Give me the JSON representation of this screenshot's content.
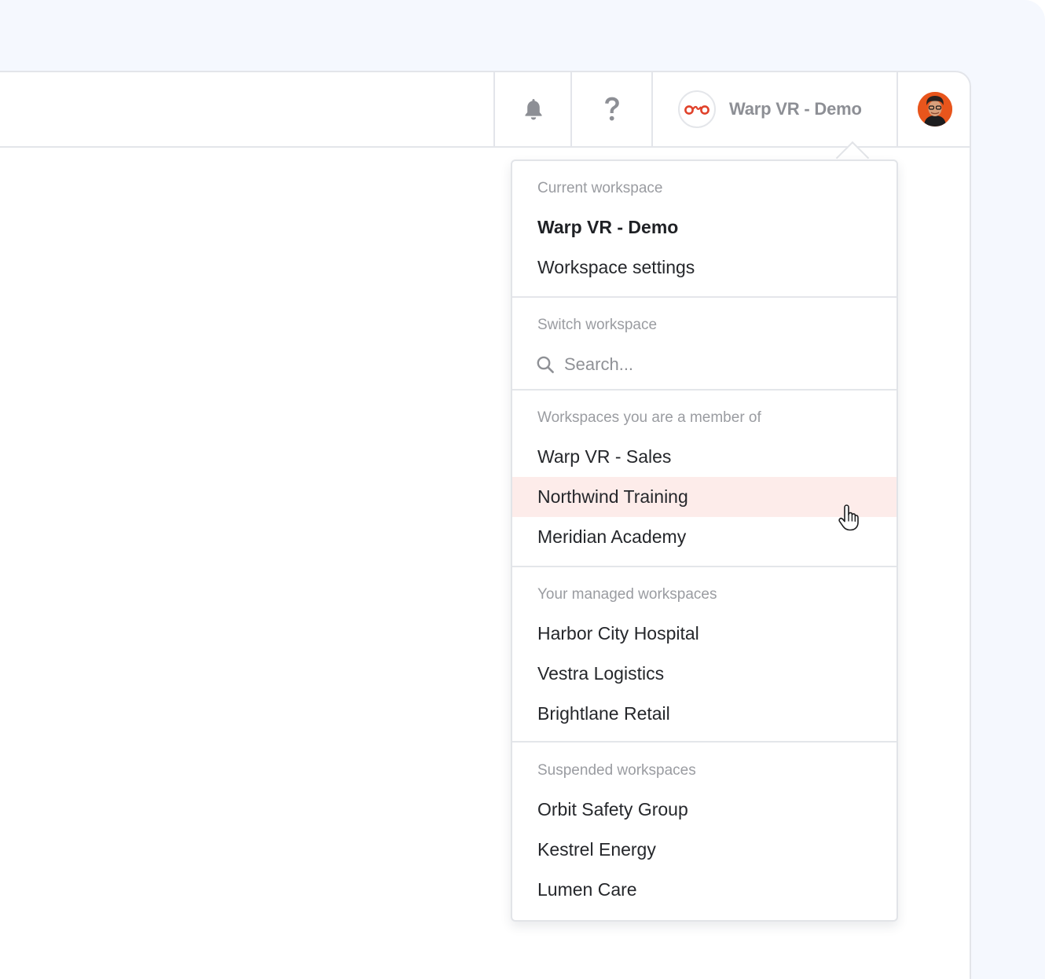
{
  "topbar": {
    "notifications_icon": "bell-icon",
    "help_icon": "question-mark-icon",
    "workspace_name": "Warp VR - Demo",
    "workspace_logo_icon": "warp-vr-logo-icon",
    "avatar": "user-avatar"
  },
  "dropdown": {
    "current": {
      "label": "Current workspace",
      "name": "Warp VR - Demo",
      "settings": "Workspace settings"
    },
    "switch": {
      "label": "Switch workspace",
      "search_placeholder": "Search...",
      "search_value": "",
      "search_icon": "search-icon"
    },
    "member": {
      "label": "Workspaces you are a member of",
      "items": [
        "Warp VR - Sales",
        "Northwind Training",
        "Meridian Academy"
      ],
      "hovered_item": "Northwind Training"
    },
    "managed": {
      "label": "Your managed workspaces",
      "items": [
        "Harbor City Hospital",
        "Vestra Logistics",
        "Brightlane Retail"
      ]
    },
    "suspended": {
      "label": "Suspended workspaces",
      "items": [
        "Orbit Safety Group",
        "Kestrel Energy",
        "Lumen Care"
      ]
    }
  },
  "colors": {
    "hover_bg": "#fdecea",
    "brand": "#e0412a",
    "muted_text": "#9a9ca1",
    "text": "#25272b",
    "border": "#e3e5ea"
  },
  "cursor_icon": "pointer-hand-icon"
}
